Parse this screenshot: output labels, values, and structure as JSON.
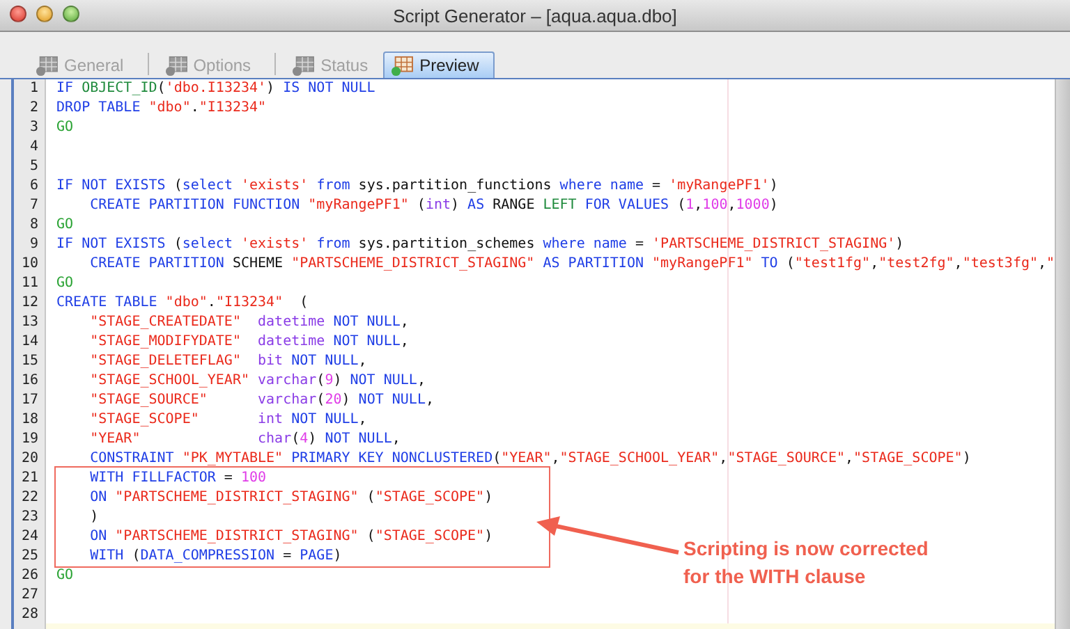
{
  "window": {
    "title": "Script Generator – [aqua.aqua.dbo]"
  },
  "tabs": [
    {
      "label": "General",
      "selected": false,
      "disabled": true
    },
    {
      "label": "Options",
      "selected": false,
      "disabled": true
    },
    {
      "label": "Status",
      "selected": false,
      "disabled": true
    },
    {
      "label": "Preview",
      "selected": true,
      "disabled": false
    }
  ],
  "editor": {
    "lines": [
      {
        "number": "1",
        "indented": false,
        "tokens": [
          {
            "kind": "kw",
            "text": "IF "
          },
          {
            "kind": "fn",
            "text": "OBJECT_ID"
          },
          {
            "kind": "plain",
            "text": "("
          },
          {
            "kind": "str",
            "text": "'dbo.I13234'"
          },
          {
            "kind": "plain",
            "text": ") "
          },
          {
            "kind": "kw",
            "text": "IS NOT NULL"
          }
        ]
      },
      {
        "number": "2",
        "indented": false,
        "tokens": [
          {
            "kind": "kw",
            "text": "DROP TABLE "
          },
          {
            "kind": "str",
            "text": "\"dbo\""
          },
          {
            "kind": "plain",
            "text": "."
          },
          {
            "kind": "str",
            "text": "\"I13234\""
          }
        ]
      },
      {
        "number": "3",
        "indented": false,
        "tokens": [
          {
            "kind": "go",
            "text": "GO"
          }
        ]
      },
      {
        "number": "4"
      },
      {
        "number": "5"
      },
      {
        "number": "6",
        "indented": false,
        "tokens": [
          {
            "kind": "kw",
            "text": "IF NOT EXISTS "
          },
          {
            "kind": "plain",
            "text": "("
          },
          {
            "kind": "kw",
            "text": "select "
          },
          {
            "kind": "str",
            "text": "'exists' "
          },
          {
            "kind": "kw",
            "text": "from "
          },
          {
            "kind": "plain",
            "text": "sys.partition_functions "
          },
          {
            "kind": "kw",
            "text": "where name "
          },
          {
            "kind": "plain",
            "text": "= "
          },
          {
            "kind": "str",
            "text": "'myRangePF1'"
          },
          {
            "kind": "plain",
            "text": ")"
          }
        ]
      },
      {
        "number": "7",
        "indented": true,
        "tokens": [
          {
            "kind": "kw",
            "text": "CREATE PARTITION FUNCTION "
          },
          {
            "kind": "str",
            "text": "\"myRangePF1\""
          },
          {
            "kind": "plain",
            "text": " ("
          },
          {
            "kind": "type",
            "text": "int"
          },
          {
            "kind": "plain",
            "text": ") "
          },
          {
            "kind": "kw",
            "text": "AS "
          },
          {
            "kind": "plain",
            "text": "RANGE "
          },
          {
            "kind": "fn",
            "text": "LEFT "
          },
          {
            "kind": "kw",
            "text": "FOR VALUES "
          },
          {
            "kind": "plain",
            "text": "("
          },
          {
            "kind": "num",
            "text": "1"
          },
          {
            "kind": "plain",
            "text": ","
          },
          {
            "kind": "num",
            "text": "100"
          },
          {
            "kind": "plain",
            "text": ","
          },
          {
            "kind": "num",
            "text": "1000"
          },
          {
            "kind": "plain",
            "text": ")"
          }
        ]
      },
      {
        "number": "8",
        "indented": false,
        "tokens": [
          {
            "kind": "go",
            "text": "GO"
          }
        ]
      },
      {
        "number": "9",
        "indented": false,
        "tokens": [
          {
            "kind": "kw",
            "text": "IF NOT EXISTS "
          },
          {
            "kind": "plain",
            "text": "("
          },
          {
            "kind": "kw",
            "text": "select "
          },
          {
            "kind": "str",
            "text": "'exists' "
          },
          {
            "kind": "kw",
            "text": "from "
          },
          {
            "kind": "plain",
            "text": "sys.partition_schemes "
          },
          {
            "kind": "kw",
            "text": "where name "
          },
          {
            "kind": "plain",
            "text": "= "
          },
          {
            "kind": "str",
            "text": "'PARTSCHEME_DISTRICT_STAGING'"
          },
          {
            "kind": "plain",
            "text": ")"
          }
        ]
      },
      {
        "number": "10",
        "indented": true,
        "tokens": [
          {
            "kind": "kw",
            "text": "CREATE PARTITION "
          },
          {
            "kind": "plain",
            "text": "SCHEME "
          },
          {
            "kind": "str",
            "text": "\"PARTSCHEME_DISTRICT_STAGING\""
          },
          {
            "kind": "kw",
            "text": " AS PARTITION "
          },
          {
            "kind": "str",
            "text": "\"myRangePF1\""
          },
          {
            "kind": "kw",
            "text": " TO "
          },
          {
            "kind": "plain",
            "text": "("
          },
          {
            "kind": "str",
            "text": "\"test1fg\""
          },
          {
            "kind": "plain",
            "text": ","
          },
          {
            "kind": "str",
            "text": "\"test2fg\""
          },
          {
            "kind": "plain",
            "text": ","
          },
          {
            "kind": "str",
            "text": "\"test3fg\""
          },
          {
            "kind": "plain",
            "text": ","
          },
          {
            "kind": "str",
            "text": "\""
          }
        ]
      },
      {
        "number": "11",
        "indented": false,
        "tokens": [
          {
            "kind": "go",
            "text": "GO"
          }
        ]
      },
      {
        "number": "12",
        "indented": false,
        "tokens": [
          {
            "kind": "kw",
            "text": "CREATE TABLE "
          },
          {
            "kind": "str",
            "text": "\"dbo\""
          },
          {
            "kind": "plain",
            "text": "."
          },
          {
            "kind": "str",
            "text": "\"I13234\""
          },
          {
            "kind": "plain",
            "text": "  ("
          }
        ]
      },
      {
        "number": "13",
        "indented": true,
        "tokens": [
          {
            "kind": "str",
            "text": "\"STAGE_CREATEDATE\""
          },
          {
            "kind": "type",
            "text": "  datetime "
          },
          {
            "kind": "kw",
            "text": "NOT NULL"
          },
          {
            "kind": "plain",
            "text": ","
          }
        ]
      },
      {
        "number": "14",
        "indented": true,
        "tokens": [
          {
            "kind": "str",
            "text": "\"STAGE_MODIFYDATE\""
          },
          {
            "kind": "type",
            "text": "  datetime "
          },
          {
            "kind": "kw",
            "text": "NOT NULL"
          },
          {
            "kind": "plain",
            "text": ","
          }
        ]
      },
      {
        "number": "15",
        "indented": true,
        "tokens": [
          {
            "kind": "str",
            "text": "\"STAGE_DELETEFLAG\""
          },
          {
            "kind": "type",
            "text": "  bit "
          },
          {
            "kind": "kw",
            "text": "NOT NULL"
          },
          {
            "kind": "plain",
            "text": ","
          }
        ]
      },
      {
        "number": "16",
        "indented": true,
        "tokens": [
          {
            "kind": "str",
            "text": "\"STAGE_SCHOOL_YEAR\""
          },
          {
            "kind": "type",
            "text": " varchar"
          },
          {
            "kind": "plain",
            "text": "("
          },
          {
            "kind": "num",
            "text": "9"
          },
          {
            "kind": "plain",
            "text": ") "
          },
          {
            "kind": "kw",
            "text": "NOT NULL"
          },
          {
            "kind": "plain",
            "text": ","
          }
        ]
      },
      {
        "number": "17",
        "indented": true,
        "tokens": [
          {
            "kind": "str",
            "text": "\"STAGE_SOURCE\""
          },
          {
            "kind": "type",
            "text": "      varchar"
          },
          {
            "kind": "plain",
            "text": "("
          },
          {
            "kind": "num",
            "text": "20"
          },
          {
            "kind": "plain",
            "text": ") "
          },
          {
            "kind": "kw",
            "text": "NOT NULL"
          },
          {
            "kind": "plain",
            "text": ","
          }
        ]
      },
      {
        "number": "18",
        "indented": true,
        "tokens": [
          {
            "kind": "str",
            "text": "\"STAGE_SCOPE\""
          },
          {
            "kind": "type",
            "text": "       int "
          },
          {
            "kind": "kw",
            "text": "NOT NULL"
          },
          {
            "kind": "plain",
            "text": ","
          }
        ]
      },
      {
        "number": "19",
        "indented": true,
        "tokens": [
          {
            "kind": "str",
            "text": "\"YEAR\""
          },
          {
            "kind": "type",
            "text": "              char"
          },
          {
            "kind": "plain",
            "text": "("
          },
          {
            "kind": "num",
            "text": "4"
          },
          {
            "kind": "plain",
            "text": ") "
          },
          {
            "kind": "kw",
            "text": "NOT NULL"
          },
          {
            "kind": "plain",
            "text": ","
          }
        ]
      },
      {
        "number": "20",
        "indented": true,
        "tokens": [
          {
            "kind": "kw",
            "text": "CONSTRAINT "
          },
          {
            "kind": "str",
            "text": "\"PK_MYTABLE\""
          },
          {
            "kind": "kw",
            "text": " PRIMARY KEY NONCLUSTERED"
          },
          {
            "kind": "plain",
            "text": "("
          },
          {
            "kind": "str",
            "text": "\"YEAR\""
          },
          {
            "kind": "plain",
            "text": ","
          },
          {
            "kind": "str",
            "text": "\"STAGE_SCHOOL_YEAR\""
          },
          {
            "kind": "plain",
            "text": ","
          },
          {
            "kind": "str",
            "text": "\"STAGE_SOURCE\""
          },
          {
            "kind": "plain",
            "text": ","
          },
          {
            "kind": "str",
            "text": "\"STAGE_SCOPE\""
          },
          {
            "kind": "plain",
            "text": ")"
          }
        ]
      },
      {
        "number": "21",
        "indented": true,
        "tokens": [
          {
            "kind": "kw",
            "text": "WITH FILLFACTOR "
          },
          {
            "kind": "plain",
            "text": "= "
          },
          {
            "kind": "num",
            "text": "100"
          }
        ]
      },
      {
        "number": "22",
        "indented": true,
        "tokens": [
          {
            "kind": "kw",
            "text": "ON "
          },
          {
            "kind": "str",
            "text": "\"PARTSCHEME_DISTRICT_STAGING\""
          },
          {
            "kind": "plain",
            "text": " ("
          },
          {
            "kind": "str",
            "text": "\"STAGE_SCOPE\""
          },
          {
            "kind": "plain",
            "text": ")"
          }
        ]
      },
      {
        "number": "23",
        "indented": true,
        "tokens": [
          {
            "kind": "plain",
            "text": ")"
          }
        ]
      },
      {
        "number": "24",
        "indented": true,
        "tokens": [
          {
            "kind": "kw",
            "text": "ON "
          },
          {
            "kind": "str",
            "text": "\"PARTSCHEME_DISTRICT_STAGING\""
          },
          {
            "kind": "plain",
            "text": " ("
          },
          {
            "kind": "str",
            "text": "\"STAGE_SCOPE\""
          },
          {
            "kind": "plain",
            "text": ")"
          }
        ]
      },
      {
        "number": "25",
        "indented": true,
        "tokens": [
          {
            "kind": "kw",
            "text": "WITH "
          },
          {
            "kind": "plain",
            "text": "("
          },
          {
            "kind": "kw",
            "text": "DATA_COMPRESSION "
          },
          {
            "kind": "plain",
            "text": "= "
          },
          {
            "kind": "kw",
            "text": "PAGE"
          },
          {
            "kind": "plain",
            "text": ")"
          }
        ]
      },
      {
        "number": "26",
        "indented": false,
        "tokens": [
          {
            "kind": "go",
            "text": "GO"
          }
        ]
      },
      {
        "number": "27"
      },
      {
        "number": "28"
      }
    ]
  },
  "callout": {
    "text": "Scripting is now corrected for the WITH clause"
  }
}
